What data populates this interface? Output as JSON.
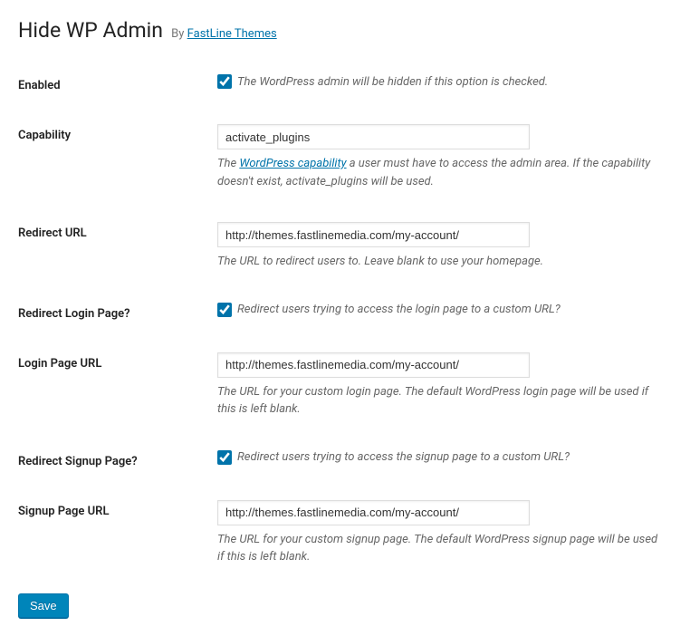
{
  "header": {
    "title": "Hide WP Admin",
    "by": "By",
    "author": "FastLine Themes"
  },
  "fields": {
    "enabled": {
      "label": "Enabled",
      "checked": true,
      "help": "The WordPress admin will be hidden if this option is checked."
    },
    "capability": {
      "label": "Capability",
      "value": "activate_plugins",
      "desc_pre": "The ",
      "desc_link": "WordPress capability",
      "desc_post": " a user must have to access the admin area. If the capability doesn't exist, activate_plugins will be used."
    },
    "redirect_url": {
      "label": "Redirect URL",
      "value": "http://themes.fastlinemedia.com/my-account/",
      "desc": "The URL to redirect users to. Leave blank to use your homepage."
    },
    "redirect_login": {
      "label": "Redirect Login Page?",
      "checked": true,
      "help": "Redirect users trying to access the login page to a custom URL?"
    },
    "login_page_url": {
      "label": "Login Page URL",
      "value": "http://themes.fastlinemedia.com/my-account/",
      "desc": "The URL for your custom login page. The default WordPress login page will be used if this is left blank."
    },
    "redirect_signup": {
      "label": "Redirect Signup Page?",
      "checked": true,
      "help": "Redirect users trying to access the signup page to a custom URL?"
    },
    "signup_page_url": {
      "label": "Signup Page URL",
      "value": "http://themes.fastlinemedia.com/my-account/",
      "desc": "The URL for your custom signup page. The default WordPress signup page will be used if this is left blank."
    }
  },
  "save_button": "Save"
}
